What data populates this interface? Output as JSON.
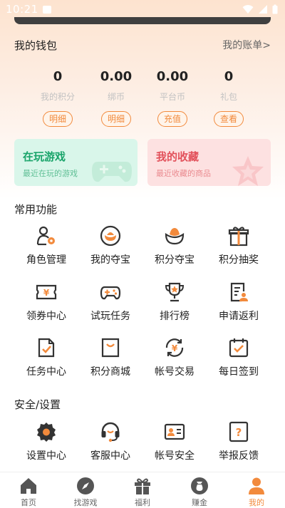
{
  "status_bar": {
    "time": "10:21"
  },
  "wallet": {
    "title": "我的钱包",
    "link": "我的账单>",
    "items": [
      {
        "value": "0",
        "label": "我的积分",
        "button": "明细"
      },
      {
        "value": "0.00",
        "label": "绑币",
        "button": "明细"
      },
      {
        "value": "0.00",
        "label": "平台币",
        "button": "充值"
      },
      {
        "value": "0",
        "label": "礼包",
        "button": "查看"
      }
    ]
  },
  "cards": {
    "playing": {
      "title": "在玩游戏",
      "subtitle": "最近在玩的游戏"
    },
    "favorites": {
      "title": "我的收藏",
      "subtitle": "最近收藏的商品"
    }
  },
  "common_functions": {
    "title": "常用功能",
    "items": [
      {
        "label": "角色管理",
        "icon": "role-manage-icon"
      },
      {
        "label": "我的夺宝",
        "icon": "my-treasure-icon"
      },
      {
        "label": "积分夺宝",
        "icon": "points-treasure-icon"
      },
      {
        "label": "积分抽奖",
        "icon": "points-lottery-icon"
      },
      {
        "label": "领券中心",
        "icon": "coupon-icon"
      },
      {
        "label": "试玩任务",
        "icon": "gamepad-icon"
      },
      {
        "label": "排行榜",
        "icon": "trophy-icon"
      },
      {
        "label": "申请返利",
        "icon": "rebate-icon"
      },
      {
        "label": "任务中心",
        "icon": "task-icon"
      },
      {
        "label": "积分商城",
        "icon": "shop-bag-icon"
      },
      {
        "label": "帐号交易",
        "icon": "account-trade-icon"
      },
      {
        "label": "每日签到",
        "icon": "checkin-icon"
      }
    ]
  },
  "security": {
    "title": "安全/设置",
    "items": [
      {
        "label": "设置中心",
        "icon": "settings-icon"
      },
      {
        "label": "客服中心",
        "icon": "headset-icon"
      },
      {
        "label": "帐号安全",
        "icon": "id-card-icon"
      },
      {
        "label": "举报反馈",
        "icon": "report-icon"
      }
    ]
  },
  "tabbar": {
    "items": [
      {
        "label": "首页",
        "icon": "home-icon"
      },
      {
        "label": "找游戏",
        "icon": "compass-icon"
      },
      {
        "label": "福利",
        "icon": "gift-icon"
      },
      {
        "label": "赚金",
        "icon": "money-bag-icon"
      },
      {
        "label": "我的",
        "icon": "person-icon",
        "active": true
      }
    ]
  },
  "colors": {
    "accent": "#f28a3c",
    "icon_dark": "#333333",
    "green": "#19a46a",
    "red": "#e2505a"
  }
}
